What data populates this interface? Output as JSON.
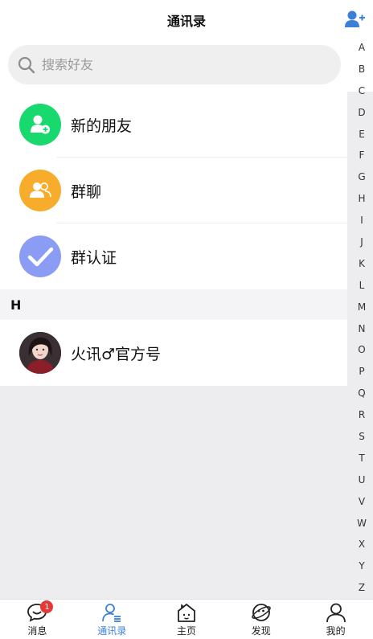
{
  "header": {
    "title": "通讯录"
  },
  "search": {
    "placeholder": "搜索好友"
  },
  "entries": [
    {
      "label": "新的朋友",
      "color": "#17d96e",
      "icon": "user-add-icon"
    },
    {
      "label": "群聊",
      "color": "#f7ad2b",
      "icon": "group-icon"
    },
    {
      "label": "群认证",
      "color": "#8b9cf5",
      "icon": "check-icon"
    }
  ],
  "sections": [
    {
      "letter": "H",
      "contacts": [
        {
          "name": "火讯♂官方号"
        }
      ]
    }
  ],
  "index_letters": [
    "A",
    "B",
    "C",
    "D",
    "E",
    "F",
    "G",
    "H",
    "I",
    "J",
    "K",
    "L",
    "M",
    "N",
    "O",
    "P",
    "Q",
    "R",
    "S",
    "T",
    "U",
    "V",
    "W",
    "X",
    "Y",
    "Z"
  ],
  "tabbar": {
    "tabs": [
      {
        "label": "消息",
        "icon": "message-icon",
        "badge": "1"
      },
      {
        "label": "通讯录",
        "icon": "contacts-icon",
        "active": true
      },
      {
        "label": "主页",
        "icon": "home-icon"
      },
      {
        "label": "发现",
        "icon": "discover-icon"
      },
      {
        "label": "我的",
        "icon": "profile-icon"
      }
    ]
  },
  "colors": {
    "accent": "#3d7fd6",
    "badge": "#e53935"
  }
}
